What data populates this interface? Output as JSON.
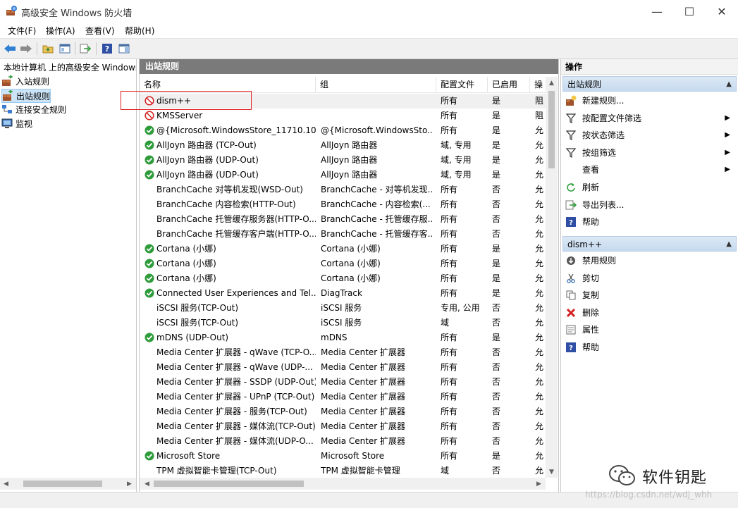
{
  "window": {
    "title": "高级安全 Windows 防火墙",
    "minimize": "—",
    "maximize": "☐",
    "close": "✕"
  },
  "menu": [
    "文件(F)",
    "操作(A)",
    "查看(V)",
    "帮助(H)"
  ],
  "toolbar": {
    "icons": [
      "back-arrow-icon",
      "forward-arrow-icon",
      "folder-up-icon",
      "show-tree-icon",
      "export-icon",
      "help-icon",
      "show-action-pane-icon"
    ]
  },
  "tree": {
    "root": "本地计算机 上的高级安全 Windows",
    "items": [
      "入站规则",
      "出站规则",
      "连接安全规则",
      "监视"
    ],
    "selected": "出站规则"
  },
  "list": {
    "header": "出站规则",
    "columns": [
      "名称",
      "组",
      "配置文件",
      "已启用",
      "操"
    ],
    "rows": [
      {
        "status": "blocked",
        "name": "dism++",
        "group": "",
        "profile": "所有",
        "enabled": "是",
        "op": "阻"
      },
      {
        "status": "blocked",
        "name": "KMSServer",
        "group": "",
        "profile": "所有",
        "enabled": "是",
        "op": "阻"
      },
      {
        "status": "allowed",
        "name": "@{Microsoft.WindowsStore_11710.10...",
        "group": "@{Microsoft.WindowsSto...",
        "profile": "所有",
        "enabled": "是",
        "op": "允"
      },
      {
        "status": "allowed",
        "name": "AllJoyn 路由器 (TCP-Out)",
        "group": "AllJoyn 路由器",
        "profile": "域, 专用",
        "enabled": "是",
        "op": "允"
      },
      {
        "status": "allowed",
        "name": "AllJoyn 路由器 (UDP-Out)",
        "group": "AllJoyn 路由器",
        "profile": "域, 专用",
        "enabled": "是",
        "op": "允"
      },
      {
        "status": "allowed",
        "name": "AllJoyn 路由器 (UDP-Out)",
        "group": "AllJoyn 路由器",
        "profile": "域, 专用",
        "enabled": "是",
        "op": "允"
      },
      {
        "status": "none",
        "name": "BranchCache 对等机发现(WSD-Out)",
        "group": "BranchCache - 对等机发现...",
        "profile": "所有",
        "enabled": "否",
        "op": "允"
      },
      {
        "status": "none",
        "name": "BranchCache 内容检索(HTTP-Out)",
        "group": "BranchCache - 内容检索(...",
        "profile": "所有",
        "enabled": "否",
        "op": "允"
      },
      {
        "status": "none",
        "name": "BranchCache 托管缓存服务器(HTTP-O...",
        "group": "BranchCache - 托管缓存服...",
        "profile": "所有",
        "enabled": "否",
        "op": "允"
      },
      {
        "status": "none",
        "name": "BranchCache 托管缓存客户端(HTTP-O...",
        "group": "BranchCache - 托管缓存客...",
        "profile": "所有",
        "enabled": "否",
        "op": "允"
      },
      {
        "status": "allowed",
        "name": "Cortana (小娜)",
        "group": "Cortana (小娜)",
        "profile": "所有",
        "enabled": "是",
        "op": "允"
      },
      {
        "status": "allowed",
        "name": "Cortana (小娜)",
        "group": "Cortana (小娜)",
        "profile": "所有",
        "enabled": "是",
        "op": "允"
      },
      {
        "status": "allowed",
        "name": "Cortana (小娜)",
        "group": "Cortana (小娜)",
        "profile": "所有",
        "enabled": "是",
        "op": "允"
      },
      {
        "status": "allowed",
        "name": "Connected User Experiences and Tel...",
        "group": "DiagTrack",
        "profile": "所有",
        "enabled": "是",
        "op": "允"
      },
      {
        "status": "none",
        "name": "iSCSI 服务(TCP-Out)",
        "group": "iSCSI 服务",
        "profile": "专用, 公用",
        "enabled": "否",
        "op": "允"
      },
      {
        "status": "none",
        "name": "iSCSI 服务(TCP-Out)",
        "group": "iSCSI 服务",
        "profile": "域",
        "enabled": "否",
        "op": "允"
      },
      {
        "status": "allowed",
        "name": "mDNS (UDP-Out)",
        "group": "mDNS",
        "profile": "所有",
        "enabled": "是",
        "op": "允"
      },
      {
        "status": "none",
        "name": "Media Center 扩展器 - qWave (TCP-O...",
        "group": "Media Center 扩展器",
        "profile": "所有",
        "enabled": "否",
        "op": "允"
      },
      {
        "status": "none",
        "name": "Media Center 扩展器 - qWave (UDP-...",
        "group": "Media Center 扩展器",
        "profile": "所有",
        "enabled": "否",
        "op": "允"
      },
      {
        "status": "none",
        "name": "Media Center 扩展器 - SSDP (UDP-Out)",
        "group": "Media Center 扩展器",
        "profile": "所有",
        "enabled": "否",
        "op": "允"
      },
      {
        "status": "none",
        "name": "Media Center 扩展器 - UPnP (TCP-Out)",
        "group": "Media Center 扩展器",
        "profile": "所有",
        "enabled": "否",
        "op": "允"
      },
      {
        "status": "none",
        "name": "Media Center 扩展器 - 服务(TCP-Out)",
        "group": "Media Center 扩展器",
        "profile": "所有",
        "enabled": "否",
        "op": "允"
      },
      {
        "status": "none",
        "name": "Media Center 扩展器 - 媒体流(TCP-Out)",
        "group": "Media Center 扩展器",
        "profile": "所有",
        "enabled": "否",
        "op": "允"
      },
      {
        "status": "none",
        "name": "Media Center 扩展器 - 媒体流(UDP-O...",
        "group": "Media Center 扩展器",
        "profile": "所有",
        "enabled": "否",
        "op": "允"
      },
      {
        "status": "allowed",
        "name": "Microsoft Store",
        "group": "Microsoft Store",
        "profile": "所有",
        "enabled": "是",
        "op": "允"
      },
      {
        "status": "none",
        "name": "TPM 虚拟智能卡管理(TCP-Out)",
        "group": "TPM 虚拟智能卡管理",
        "profile": "域",
        "enabled": "否",
        "op": "允"
      }
    ]
  },
  "actions": {
    "title": "操作",
    "section1": {
      "header": "出站规则",
      "items": [
        {
          "icon": "new-rule-icon",
          "label": "新建规则...",
          "submenu": false
        },
        {
          "icon": "filter-icon",
          "label": "按配置文件筛选",
          "submenu": true
        },
        {
          "icon": "filter-icon",
          "label": "按状态筛选",
          "submenu": true
        },
        {
          "icon": "filter-icon",
          "label": "按组筛选",
          "submenu": true
        },
        {
          "icon": "",
          "label": "查看",
          "submenu": true
        },
        {
          "icon": "refresh-icon",
          "label": "刷新",
          "submenu": false
        },
        {
          "icon": "export-list-icon",
          "label": "导出列表...",
          "submenu": false
        },
        {
          "icon": "help-icon",
          "label": "帮助",
          "submenu": false
        }
      ]
    },
    "section2": {
      "header": "dism++",
      "items": [
        {
          "icon": "disable-rule-icon",
          "label": "禁用规则"
        },
        {
          "icon": "cut-icon",
          "label": "剪切"
        },
        {
          "icon": "copy-icon",
          "label": "复制"
        },
        {
          "icon": "delete-icon",
          "label": "删除"
        },
        {
          "icon": "properties-icon",
          "label": "属性"
        },
        {
          "icon": "help-icon",
          "label": "帮助"
        }
      ]
    }
  },
  "watermark": {
    "text": "软件钥匙",
    "url": "https://blog.csdn.net/wdj_whh"
  },
  "colors": {
    "allowed": "#2e9c3b",
    "blocked": "#d42020",
    "highlight": "#e02020",
    "pane_header": "#7a7a7a"
  }
}
